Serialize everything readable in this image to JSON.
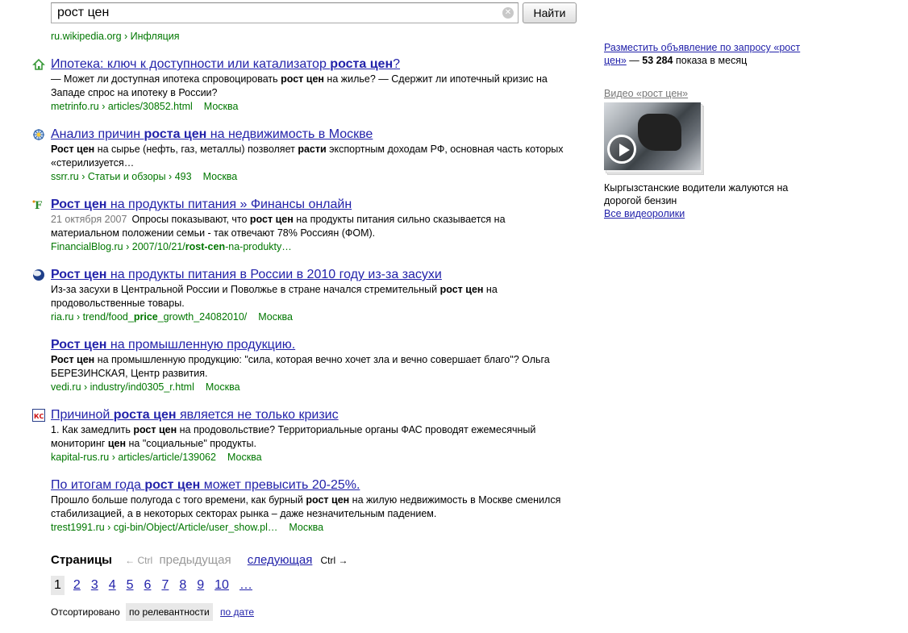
{
  "search": {
    "query": "рост цен",
    "button_label": "Найти",
    "clear_glyph": "✕"
  },
  "top_crumb": "ru.wikipedia.org › Инфляция",
  "results": [
    {
      "favicon": "house-icon",
      "title_parts": [
        [
          "Ипотека: ключ к доступности или катализатор ",
          false
        ],
        [
          "роста цен",
          true
        ],
        [
          "?",
          false
        ]
      ],
      "snippet_parts": [
        [
          "— Может ли доступная ипотека спровоцировать ",
          false
        ],
        [
          "рост цен",
          true
        ],
        [
          " на жилье? — Сдержит ли ипотечный кризис на Западе спрос на ипотеку в России?",
          false
        ]
      ],
      "url": "metrinfo.ru › articles/30852.html",
      "city": "Москва"
    },
    {
      "favicon": "gear-globe-icon",
      "title_parts": [
        [
          "Анализ причин ",
          false
        ],
        [
          "роста цен",
          true
        ],
        [
          " на недвижимость в Москве",
          false
        ]
      ],
      "snippet_parts": [
        [
          "Рост цен",
          true
        ],
        [
          " на сырье (нефть, газ, металлы) позволяет ",
          false
        ],
        [
          "расти",
          true
        ],
        [
          " экспортным доходам РФ, основная часть которых «стерилизуется…",
          false
        ]
      ],
      "url": "ssrr.ru › Статьи и обзоры › 493",
      "city": "Москва"
    },
    {
      "favicon": "f-letter-icon",
      "title_parts": [
        [
          "Рост цен",
          true
        ],
        [
          " на продукты питания » Финансы онлайн",
          false
        ]
      ],
      "date": "21 октября 2007",
      "snippet_parts": [
        [
          "Опросы показывают, что ",
          false
        ],
        [
          "рост цен",
          true
        ],
        [
          " на продукты питания сильно сказывается на материальном положении семьи - так отвечают 78% Россиян (ФОМ).",
          false
        ]
      ],
      "url_parts": [
        [
          "FinancialBlog.ru › 2007/10/21/",
          false
        ],
        [
          "rost-cen",
          true
        ],
        [
          "-na-produkty…",
          false
        ]
      ],
      "city": ""
    },
    {
      "favicon": "globe-icon",
      "title_parts": [
        [
          "Рост цен",
          true
        ],
        [
          " на продукты питания в России в 2010 году из-за засухи",
          false
        ]
      ],
      "snippet_parts": [
        [
          "Из-за засухи в Центральной России и Поволжье в стране начался стремительный ",
          false
        ],
        [
          "рост цен",
          true
        ],
        [
          " на продовольственные товары.",
          false
        ]
      ],
      "url_parts": [
        [
          "ria.ru › trend/food_",
          false
        ],
        [
          "price",
          true
        ],
        [
          "_growth_24082010/",
          false
        ]
      ],
      "city": "Москва"
    },
    {
      "favicon": "",
      "title_parts": [
        [
          "Рост цен",
          true
        ],
        [
          " на промышленную продукцию.",
          false
        ]
      ],
      "snippet_parts": [
        [
          "Рост цен",
          true
        ],
        [
          " на промышленную продукцию: \"сила, которая вечно хочет зла и вечно совершает благо\"? Ольга БЕРЕЗИНСКАЯ, Центр развития.",
          false
        ]
      ],
      "url": "vedi.ru › industry/ind0305_r.html",
      "city": "Москва"
    },
    {
      "favicon": "ks-icon",
      "title_parts": [
        [
          "Причиной ",
          false
        ],
        [
          "роста цен",
          true
        ],
        [
          " является не только кризис",
          false
        ]
      ],
      "snippet_parts": [
        [
          "1. Как замедлить ",
          false
        ],
        [
          "рост цен",
          true
        ],
        [
          " на продовольствие? Территориальные органы ФАС проводят ежемесячный мониторинг ",
          false
        ],
        [
          "цен",
          true
        ],
        [
          " на \"социальные\" продукты.",
          false
        ]
      ],
      "url": "kapital-rus.ru › articles/article/139062",
      "city": "Москва"
    },
    {
      "favicon": "",
      "title_parts": [
        [
          "По итогам года ",
          false
        ],
        [
          "рост цен",
          true
        ],
        [
          " может превысить 20-25%.",
          false
        ]
      ],
      "snippet_parts": [
        [
          "Прошло больше полугода с того времени, как бурный ",
          false
        ],
        [
          "рост цен",
          true
        ],
        [
          " на жилую недвижимость в Москве сменился стабилизацией, а в некоторых секторах рынка – даже незначительным падением.",
          false
        ]
      ],
      "url": "trest1991.ru › cgi-bin/Object/Article/user_show.pl…",
      "city": "Москва"
    }
  ],
  "pager": {
    "label": "Страницы",
    "prev_ctrl": "← Ctrl",
    "prev": "предыдущая",
    "next": "следующая",
    "next_ctrl": "Ctrl →",
    "pages": [
      "1",
      "2",
      "3",
      "4",
      "5",
      "6",
      "7",
      "8",
      "9",
      "10",
      "…"
    ],
    "current": "1"
  },
  "sorting": {
    "label": "Отсортировано",
    "current": "по релевантности",
    "alt": "по дате"
  },
  "ad": {
    "link_text": "Разместить объявление по запросу «рост цен»",
    "dash": " — ",
    "count": "53 284",
    "tail": " показа в месяц"
  },
  "video": {
    "header": "Видео «рост цен»",
    "caption": "Кыргызстанские водители жалуются на дорогой бензин",
    "all_link": "Все видеоролики"
  },
  "colors": {
    "link": "#2222aa",
    "url_green": "#007700",
    "muted": "#777777"
  }
}
